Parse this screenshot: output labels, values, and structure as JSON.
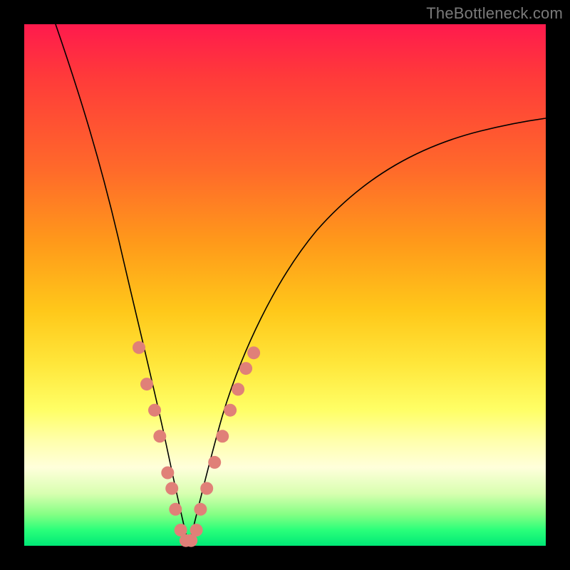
{
  "watermark": "TheBottleneck.com",
  "chart_data": {
    "type": "line",
    "title": "",
    "xlabel": "",
    "ylabel": "",
    "xlim": [
      0,
      100
    ],
    "ylim": [
      0,
      100
    ],
    "grid": false,
    "legend": false,
    "background_gradient": [
      "#ff1a4d",
      "#ff6a2a",
      "#ffc81a",
      "#ffff66",
      "#2aff7a"
    ],
    "series": [
      {
        "name": "left-arm",
        "x": [
          6,
          10,
          14,
          18,
          21,
          24,
          26,
          28,
          29.5,
          30.5,
          31.5
        ],
        "values": [
          100,
          88,
          75,
          59,
          44,
          31,
          20,
          12,
          6,
          2,
          0
        ]
      },
      {
        "name": "right-arm",
        "x": [
          31.5,
          33,
          35,
          38,
          42,
          48,
          56,
          66,
          78,
          90,
          100
        ],
        "values": [
          0,
          2,
          6,
          14,
          24,
          37,
          50,
          62,
          72,
          78,
          82
        ]
      }
    ],
    "markers": {
      "name": "salmon-dots",
      "color": "#e08078",
      "x": [
        22.0,
        23.5,
        25.0,
        26.0,
        27.5,
        28.3,
        29.0,
        30.0,
        31.0,
        32.0,
        33.0,
        33.8,
        35.0,
        36.5,
        38.0,
        39.5,
        41.0,
        42.5,
        44.0
      ],
      "values": [
        38.0,
        31.0,
        26.0,
        21.0,
        14.0,
        11.0,
        7.0,
        3.0,
        1.0,
        1.0,
        3.0,
        7.0,
        11.0,
        16.0,
        21.0,
        26.0,
        30.0,
        34.0,
        37.0
      ]
    }
  }
}
